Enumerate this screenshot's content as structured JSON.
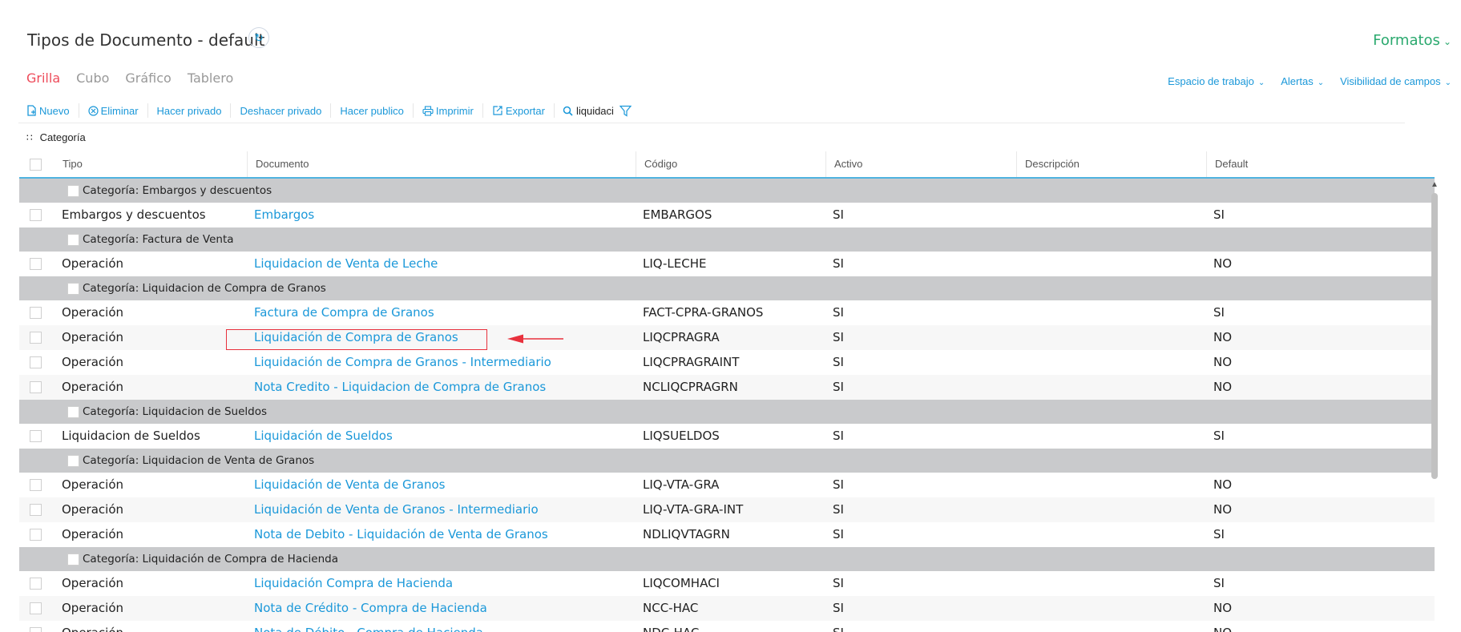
{
  "header": {
    "title": "Tipos de Documento - default",
    "formatos_label": "Formatos"
  },
  "tabs": [
    {
      "label": "Grilla",
      "active": true
    },
    {
      "label": "Cubo",
      "active": false
    },
    {
      "label": "Gráfico",
      "active": false
    },
    {
      "label": "Tablero",
      "active": false
    }
  ],
  "right_menu": [
    {
      "label": "Espacio de trabajo"
    },
    {
      "label": "Alertas"
    },
    {
      "label": "Visibilidad de campos"
    }
  ],
  "toolbar": {
    "nuevo": "Nuevo",
    "eliminar": "Eliminar",
    "hacer_privado": "Hacer privado",
    "deshacer_privado": "Deshacer privado",
    "hacer_publico": "Hacer publico",
    "imprimir": "Imprimir",
    "exportar": "Exportar",
    "search_value": "liquidaci"
  },
  "group_by": "Categoría",
  "columns": [
    "Tipo",
    "Documento",
    "Código",
    "Activo",
    "Descripción",
    "Default"
  ],
  "rows": [
    {
      "group": "Categoría: Embargos y descuentos"
    },
    {
      "tipo": "Embargos y descuentos",
      "documento": "Embargos",
      "codigo": "EMBARGOS",
      "activo": "SI",
      "descripcion": "",
      "default": "SI"
    },
    {
      "group": "Categoría: Factura de Venta"
    },
    {
      "tipo": "Operación",
      "documento": "Liquidacion de Venta de Leche",
      "codigo": "LIQ-LECHE",
      "activo": "SI",
      "descripcion": "",
      "default": "NO"
    },
    {
      "group": "Categoría: Liquidacion de Compra de Granos"
    },
    {
      "tipo": "Operación",
      "documento": "Factura de Compra de Granos",
      "codigo": "FACT-CPRA-GRANOS",
      "activo": "SI",
      "descripcion": "",
      "default": "SI"
    },
    {
      "tipo": "Operación",
      "documento": "Liquidación de Compra de Granos",
      "codigo": "LIQCPRAGRA",
      "activo": "SI",
      "descripcion": "",
      "default": "NO"
    },
    {
      "tipo": "Operación",
      "documento": "Liquidación de Compra de Granos - Intermediario",
      "codigo": "LIQCPRAGRAINT",
      "activo": "SI",
      "descripcion": "",
      "default": "NO"
    },
    {
      "tipo": "Operación",
      "documento": "Nota Credito - Liquidacion de Compra de Granos",
      "codigo": "NCLIQCPRAGRN",
      "activo": "SI",
      "descripcion": "",
      "default": "NO"
    },
    {
      "group": "Categoría: Liquidacion de Sueldos"
    },
    {
      "tipo": "Liquidacion de Sueldos",
      "documento": "Liquidación de Sueldos",
      "codigo": "LIQSUELDOS",
      "activo": "SI",
      "descripcion": "",
      "default": "SI"
    },
    {
      "group": "Categoría: Liquidacion de Venta de Granos"
    },
    {
      "tipo": "Operación",
      "documento": "Liquidación de Venta de Granos",
      "codigo": "LIQ-VTA-GRA",
      "activo": "SI",
      "descripcion": "",
      "default": "NO"
    },
    {
      "tipo": "Operación",
      "documento": "Liquidación de Venta de Granos - Intermediario",
      "codigo": "LIQ-VTA-GRA-INT",
      "activo": "SI",
      "descripcion": "",
      "default": "NO"
    },
    {
      "tipo": "Operación",
      "documento": "Nota de Debito - Liquidación de Venta de Granos",
      "codigo": "NDLIQVTAGRN",
      "activo": "SI",
      "descripcion": "",
      "default": "SI"
    },
    {
      "group": "Categoría: Liquidación de Compra de Hacienda"
    },
    {
      "tipo": "Operación",
      "documento": "Liquidación Compra de Hacienda",
      "codigo": "LIQCOMHACI",
      "activo": "SI",
      "descripcion": "",
      "default": "SI"
    },
    {
      "tipo": "Operación",
      "documento": "Nota de Crédito - Compra de Hacienda",
      "codigo": "NCC-HAC",
      "activo": "SI",
      "descripcion": "",
      "default": "NO"
    },
    {
      "tipo": "Operación",
      "documento": "Nota de Débito - Compra de Hacienda",
      "codigo": "NDC-HAC",
      "activo": "SI",
      "descripcion": "",
      "default": "NO"
    }
  ],
  "colors": {
    "accent_blue": "#1b98d9",
    "active_tab": "#ee4b5a",
    "formatos_green": "#2aa96e",
    "group_row_bg": "#c9cacc",
    "annotation_red": "#e8313d"
  }
}
